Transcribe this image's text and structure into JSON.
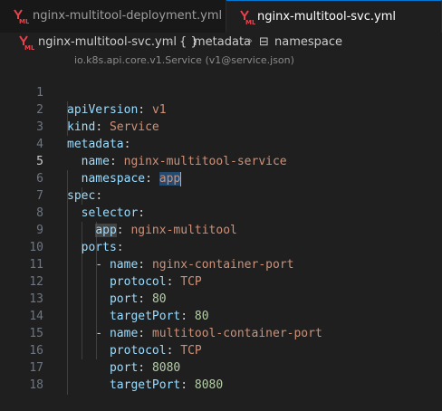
{
  "tabs": [
    {
      "label": "nginx-multitool-deployment.yml",
      "active": false
    },
    {
      "label": "nginx-multitool-svc.yml",
      "active": true
    }
  ],
  "breadcrumb": {
    "file": "nginx-multitool-svc.yml",
    "sep": "›",
    "obj_icon": "{ }",
    "obj": "metadata",
    "field_icon": "⊟",
    "field": "namespace"
  },
  "schema_hint": "io.k8s.api.core.v1.Service (v1@service.json)",
  "editor": {
    "active_line": 5,
    "lines": [
      {
        "n": "1",
        "key": "apiVersion",
        "val": "v1"
      },
      {
        "n": "2",
        "key": "kind",
        "val": "Service"
      },
      {
        "n": "3",
        "key": "metadata",
        "val": ""
      },
      {
        "n": "4",
        "key": "name",
        "val": "nginx-multitool-service"
      },
      {
        "n": "5",
        "key": "namespace",
        "val": "app"
      },
      {
        "n": "6",
        "key": "spec",
        "val": ""
      },
      {
        "n": "7",
        "key": "selector",
        "val": ""
      },
      {
        "n": "8",
        "key": "app",
        "val": "nginx-multitool"
      },
      {
        "n": "9",
        "key": "ports",
        "val": ""
      },
      {
        "n": "10",
        "key": "name",
        "val": "nginx-container-port"
      },
      {
        "n": "11",
        "key": "protocol",
        "val": "TCP"
      },
      {
        "n": "12",
        "key": "port",
        "val": "80"
      },
      {
        "n": "13",
        "key": "targetPort",
        "val": "80"
      },
      {
        "n": "14",
        "key": "name",
        "val": "multitool-container-port"
      },
      {
        "n": "15",
        "key": "protocol",
        "val": "TCP"
      },
      {
        "n": "16",
        "key": "port",
        "val": "8080"
      },
      {
        "n": "17",
        "key": "targetPort",
        "val": "8080"
      },
      {
        "n": "18",
        "key": "",
        "val": ""
      }
    ]
  },
  "colors": {
    "key": "#9cdcfe",
    "string": "#ce9178",
    "number": "#b5cea8",
    "active_tab_border": "#0078d4",
    "yml_icon": "#e8424d"
  }
}
